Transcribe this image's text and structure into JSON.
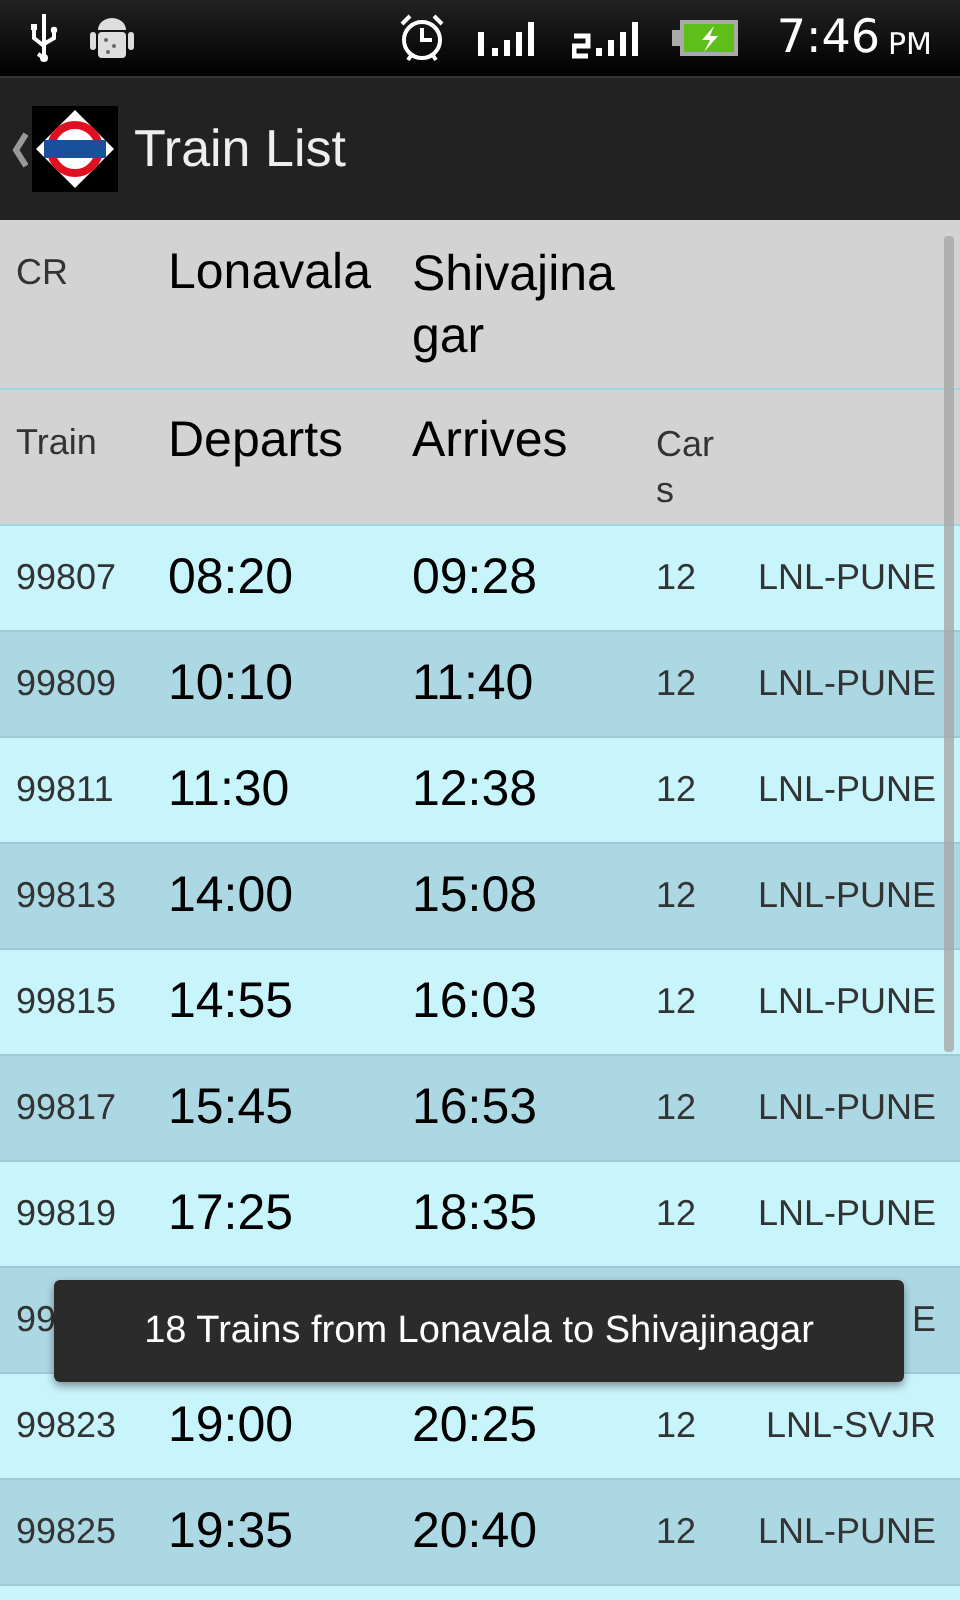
{
  "status_bar": {
    "time": "7:46",
    "ampm": "PM"
  },
  "action_bar": {
    "title": "Train List"
  },
  "header": {
    "line": "CR",
    "from": "Lonavala",
    "to": "Shivajinagar",
    "col_train": "Train",
    "col_departs": "Departs",
    "col_arrives": "Arrives",
    "col_cars": "Cars"
  },
  "rows": [
    {
      "train": "99807",
      "departs": "08:20",
      "arrives": "09:28",
      "cars": "12",
      "route": "LNL-PUNE"
    },
    {
      "train": "99809",
      "departs": "10:10",
      "arrives": "11:40",
      "cars": "12",
      "route": "LNL-PUNE"
    },
    {
      "train": "99811",
      "departs": "11:30",
      "arrives": "12:38",
      "cars": "12",
      "route": "LNL-PUNE"
    },
    {
      "train": "99813",
      "departs": "14:00",
      "arrives": "15:08",
      "cars": "12",
      "route": "LNL-PUNE"
    },
    {
      "train": "99815",
      "departs": "14:55",
      "arrives": "16:03",
      "cars": "12",
      "route": "LNL-PUNE"
    },
    {
      "train": "99817",
      "departs": "15:45",
      "arrives": "16:53",
      "cars": "12",
      "route": "LNL-PUNE"
    },
    {
      "train": "99819",
      "departs": "17:25",
      "arrives": "18:35",
      "cars": "12",
      "route": "LNL-PUNE"
    },
    {
      "train": "99",
      "route": "E"
    },
    {
      "train": "99823",
      "departs": "19:00",
      "arrives": "20:25",
      "cars": "12",
      "route": "LNL-SVJR"
    },
    {
      "train": "99825",
      "departs": "19:35",
      "arrives": "20:40",
      "cars": "12",
      "route": "LNL-PUNE"
    },
    {}
  ],
  "toast": {
    "text": "18 Trains from Lonavala to Shivajinagar"
  }
}
